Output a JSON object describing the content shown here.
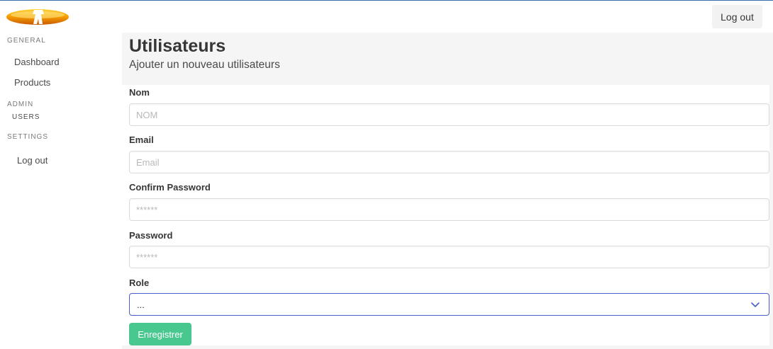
{
  "header": {
    "logout_label": "Log out"
  },
  "sidebar": {
    "general_label": "General",
    "items_general": [
      {
        "label": "Dashboard"
      },
      {
        "label": "Products"
      }
    ],
    "admin_label": "Admin",
    "items_admin": [
      {
        "label": "Users"
      }
    ],
    "settings_label": "Settings",
    "items_settings": [
      {
        "label": "Log out"
      }
    ]
  },
  "hero": {
    "title": "Utilisateurs",
    "subtitle": "Ajouter un nouveau utilisateurs"
  },
  "form": {
    "nom_label": "Nom",
    "nom_placeholder": "NOM",
    "email_label": "Email",
    "email_placeholder": "Email",
    "confirm_password_label": "Confirm Password",
    "confirm_password_placeholder": "******",
    "password_label": "Password",
    "password_placeholder": "******",
    "role_label": "Role",
    "role_value": "...",
    "submit_label": "Enregistrer"
  },
  "colors": {
    "accent_green": "#48c78e",
    "select_border": "#485fc7",
    "logo_orange": "#f5a000"
  }
}
